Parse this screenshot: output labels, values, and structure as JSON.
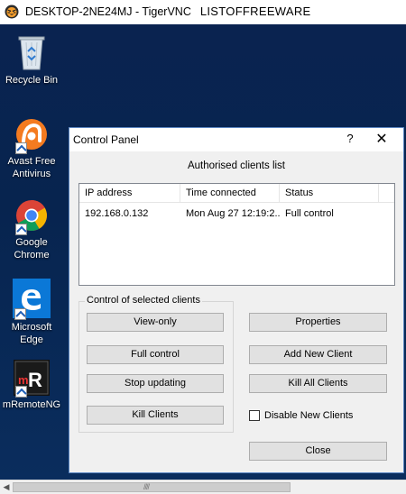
{
  "vnc_window": {
    "title": "DESKTOP-2NE24MJ - TigerVNC",
    "site_label": "LISTOFFREEWARE"
  },
  "desktop_icons": [
    {
      "label_line1": "Recycle Bin",
      "label_line2": "",
      "icon": "recycle-bin-icon"
    },
    {
      "label_line1": "Avast Free",
      "label_line2": "Antivirus",
      "icon": "avast-icon"
    },
    {
      "label_line1": "Google",
      "label_line2": "Chrome",
      "icon": "chrome-icon"
    },
    {
      "label_line1": "Microsoft",
      "label_line2": "Edge",
      "icon": "edge-icon"
    },
    {
      "label_line1": "mRemoteNG",
      "label_line2": "",
      "icon": "mremoteng-icon"
    }
  ],
  "dialog": {
    "title": "Control Panel",
    "help_label": "?",
    "close_label": "✕",
    "caption": "Authorised clients list",
    "columns": [
      "IP address",
      "Time connected",
      "Status"
    ],
    "rows": [
      {
        "ip": "192.168.0.132",
        "time": "Mon Aug 27 12:19:2...",
        "status": "Full control"
      }
    ],
    "group_title": "Control of selected clients",
    "buttons_left": [
      "View-only",
      "Full control",
      "Stop updating",
      "Kill Clients"
    ],
    "buttons_right": [
      "Properties",
      "Add New Client",
      "Kill All Clients"
    ],
    "checkbox_label": "Disable New Clients",
    "checkbox_checked": false,
    "close_button": "Close"
  },
  "scrollbar": {
    "left_arrow": "◀",
    "grip": "////"
  },
  "colors": {
    "desktop_bg": "#07244f",
    "dialog_bg": "#f0f0f0",
    "dialog_border": "#5b86c2",
    "avast_orange": "#f47b20",
    "edge_blue": "#0b78d7"
  }
}
